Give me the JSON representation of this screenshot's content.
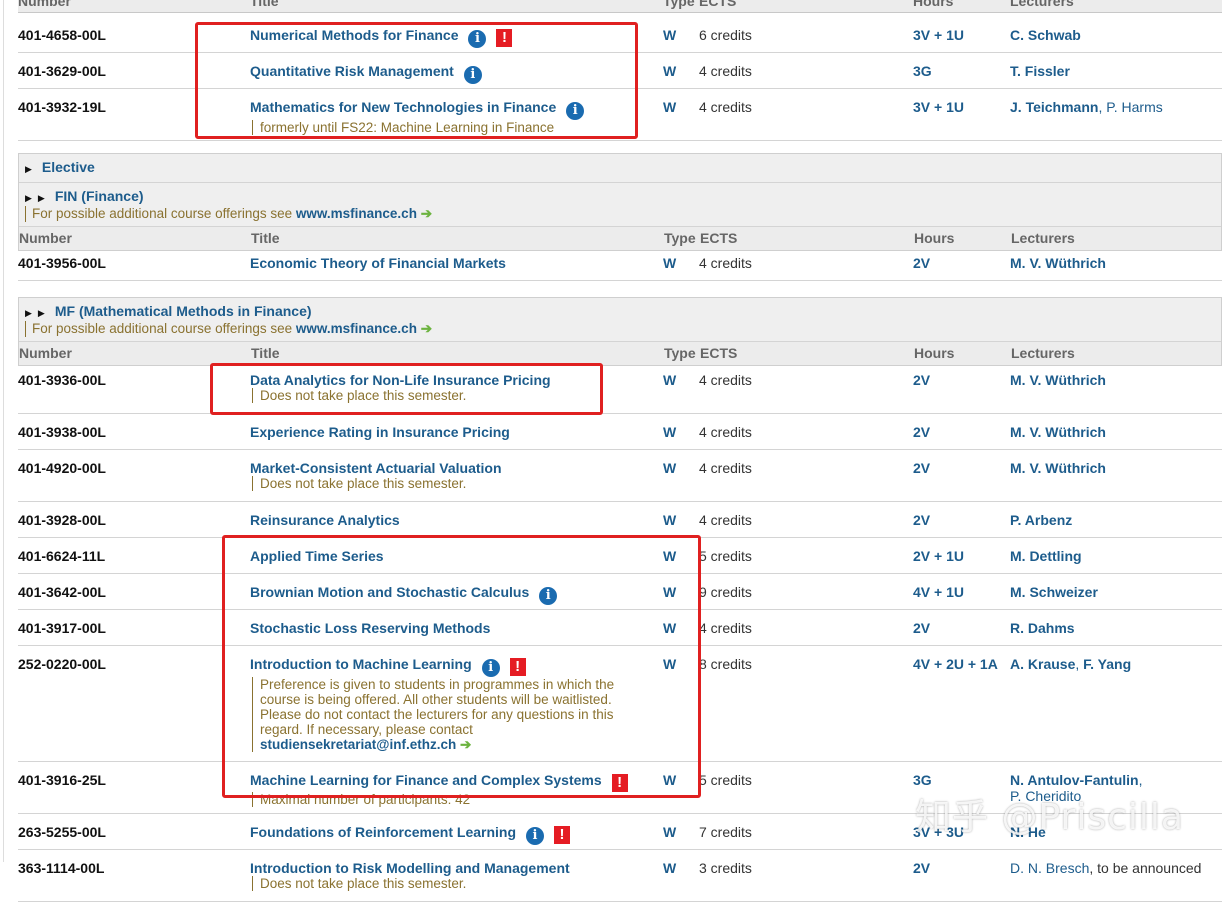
{
  "columns": {
    "number": "Number",
    "title": "Title",
    "type": "Type",
    "ects": "ECTS",
    "hours": "Hours",
    "lecturers": "Lecturers"
  },
  "group1": [
    {
      "number": "401-4658-00L",
      "title": "Numerical Methods for Finance",
      "info": true,
      "alert": true,
      "notes": [],
      "type": "W",
      "ects": "6 credits",
      "hours": "3V + 1U",
      "lecturers": [
        {
          "name": "C. Schwab",
          "style": "b"
        }
      ]
    },
    {
      "number": "401-3629-00L",
      "title": "Quantitative Risk Management",
      "info": true,
      "alert": false,
      "notes": [],
      "type": "W",
      "ects": "4 credits",
      "hours": "3G",
      "lecturers": [
        {
          "name": "T. Fissler",
          "style": "b"
        }
      ]
    },
    {
      "number": "401-3932-19L",
      "title": "Mathematics for New Technologies in Finance",
      "info": true,
      "alert": false,
      "notes": [
        "formerly until FS22: Machine Learning in Finance"
      ],
      "type": "W",
      "ects": "4 credits",
      "hours": "3V + 1U",
      "lecturers": [
        {
          "name": "J. Teichmann",
          "style": "b"
        },
        {
          "name": ", P. Harms",
          "style": "n"
        }
      ]
    }
  ],
  "elective": {
    "label": "Elective"
  },
  "fin": {
    "label": "FIN (Finance)",
    "note": "For possible additional course offerings see ",
    "link": "www.msfinance.ch"
  },
  "group2": [
    {
      "number": "401-3956-00L",
      "title": "Economic Theory of Financial Markets",
      "info": false,
      "alert": false,
      "notes": [],
      "type": "W",
      "ects": "4 credits",
      "hours": "2V",
      "lecturers": [
        {
          "name": "M. V. Wüthrich",
          "style": "b"
        }
      ]
    }
  ],
  "mf": {
    "label": "MF (Mathematical Methods in Finance)",
    "note": "For possible additional course offerings see ",
    "link": "www.msfinance.ch"
  },
  "group3": [
    {
      "number": "401-3936-00L",
      "title": "Data Analytics for Non-Life Insurance Pricing",
      "info": false,
      "alert": false,
      "notes": [
        "Does not take place this semester."
      ],
      "type": "W",
      "ects": "4 credits",
      "hours": "2V",
      "lecturers": [
        {
          "name": "M. V. Wüthrich",
          "style": "b"
        }
      ]
    },
    {
      "number": "401-3938-00L",
      "title": "Experience Rating in Insurance Pricing",
      "info": false,
      "alert": false,
      "notes": [],
      "type": "W",
      "ects": "4 credits",
      "hours": "2V",
      "lecturers": [
        {
          "name": "M. V. Wüthrich",
          "style": "b"
        }
      ]
    },
    {
      "number": "401-4920-00L",
      "title": "Market-Consistent Actuarial Valuation",
      "info": false,
      "alert": false,
      "notes": [
        "Does not take place this semester."
      ],
      "type": "W",
      "ects": "4 credits",
      "hours": "2V",
      "lecturers": [
        {
          "name": "M. V. Wüthrich",
          "style": "b"
        }
      ]
    },
    {
      "number": "401-3928-00L",
      "title": "Reinsurance Analytics",
      "info": false,
      "alert": false,
      "notes": [],
      "type": "W",
      "ects": "4 credits",
      "hours": "2V",
      "lecturers": [
        {
          "name": "P. Arbenz",
          "style": "b"
        }
      ]
    },
    {
      "number": "401-6624-11L",
      "title": "Applied Time Series",
      "info": false,
      "alert": false,
      "notes": [],
      "type": "W",
      "ects": "5 credits",
      "hours": "2V + 1U",
      "lecturers": [
        {
          "name": "M. Dettling",
          "style": "b"
        }
      ]
    },
    {
      "number": "401-3642-00L",
      "title": "Brownian Motion and Stochastic Calculus",
      "info": true,
      "alert": false,
      "notes": [],
      "type": "W",
      "ects": "9 credits",
      "hours": "4V + 1U",
      "lecturers": [
        {
          "name": "M. Schweizer",
          "style": "b"
        }
      ]
    },
    {
      "number": "401-3917-00L",
      "title": "Stochastic Loss Reserving Methods",
      "info": false,
      "alert": false,
      "notes": [],
      "type": "W",
      "ects": "4 credits",
      "hours": "2V",
      "lecturers": [
        {
          "name": "R. Dahms",
          "style": "b"
        }
      ]
    },
    {
      "number": "252-0220-00L",
      "title": "Introduction to Machine Learning",
      "info": true,
      "alert": true,
      "notes": [
        "Preference is given to students in programmes in which the",
        "course is being offered. All other students will be waitlisted.",
        "Please do not contact the lecturers for any questions in this",
        "regard. If necessary, please contact"
      ],
      "note_link": "studiensekretariat@inf.ethz.ch",
      "type": "W",
      "ects": "8 credits",
      "hours": "4V + 2U + 1A",
      "lecturers": [
        {
          "name": "A. Krause",
          "style": "b"
        },
        {
          "name": ", ",
          "style": "n"
        },
        {
          "name": "F. Yang",
          "style": "b"
        }
      ]
    },
    {
      "number": "401-3916-25L",
      "title": "Machine Learning for Finance and Complex Systems",
      "info": false,
      "alert": true,
      "notes": [
        "Maximal number of participants: 42"
      ],
      "type": "W",
      "ects": "5 credits",
      "hours": "3G",
      "lecturers": [
        {
          "name": "N. Antulov-Fantulin",
          "style": "b"
        },
        {
          "name": ",",
          "style": "n"
        },
        {
          "name": "P. Cheridito",
          "style": "br"
        }
      ]
    },
    {
      "number": "263-5255-00L",
      "title": "Foundations of Reinforcement Learning",
      "info": true,
      "alert": true,
      "notes": [],
      "type": "W",
      "ects": "7 credits",
      "hours": "3V + 3U",
      "lecturers": [
        {
          "name": "N. He",
          "style": "b"
        }
      ]
    },
    {
      "number": "363-1114-00L",
      "title": "Introduction to Risk Modelling and Management",
      "info": false,
      "alert": false,
      "notes": [
        "Does not take place this semester."
      ],
      "type": "W",
      "ects": "3 credits",
      "hours": "2V",
      "lecturers": [
        {
          "name": "D. N. Bresch",
          "style": "n"
        },
        {
          "name": ", to be announced",
          "style": "p"
        }
      ]
    }
  ],
  "icons": {
    "info": "i",
    "alert": "!",
    "arrow": "➔",
    "triangle": "▶"
  },
  "watermark": "知乎 @Priscilla"
}
